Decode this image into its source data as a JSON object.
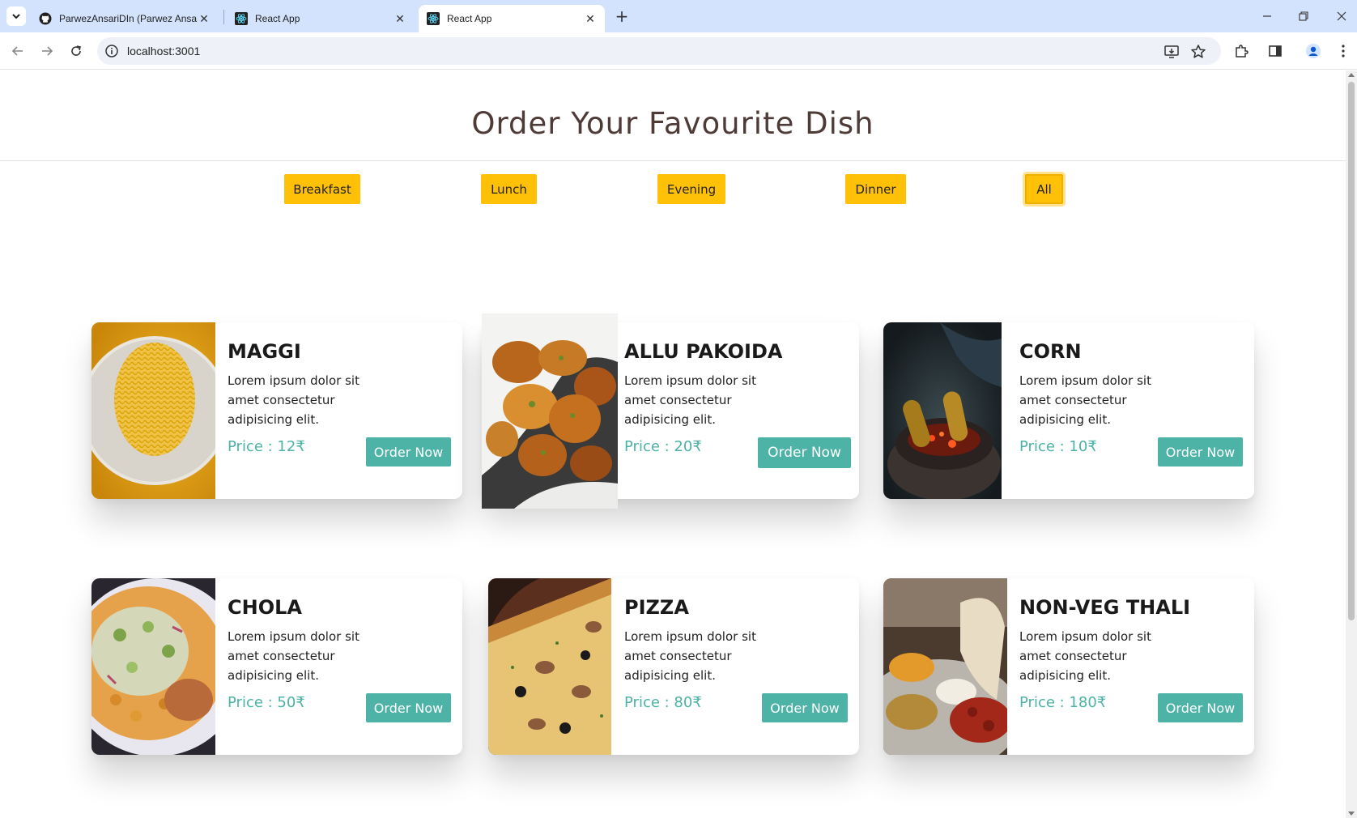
{
  "browser": {
    "tabs": [
      {
        "title": "ParwezAnsariDIn (Parwez Ansari)",
        "favicon": "github-icon",
        "active": false
      },
      {
        "title": "React App",
        "favicon": "react-icon",
        "active": false
      },
      {
        "title": "React App",
        "favicon": "react-icon",
        "active": true
      }
    ],
    "url": "localhost:3001"
  },
  "page": {
    "title": "Order Your Favourite Dish",
    "filters": [
      "Breakfast",
      "Lunch",
      "Evening",
      "Dinner",
      "All"
    ],
    "active_filter": "All",
    "order_label": "Order Now",
    "dishes": [
      {
        "name": "MAGGI",
        "desc": "Lorem ipsum dolor sit amet consectetur adipisicing elit.",
        "price": "Price : 12₹"
      },
      {
        "name": "ALLU PAKOIDA",
        "desc": "Lorem ipsum dolor sit amet consectetur adipisicing elit.",
        "price": "Price : 20₹"
      },
      {
        "name": "CORN",
        "desc": "Lorem ipsum dolor sit amet consectetur adipisicing elit.",
        "price": "Price : 10₹"
      },
      {
        "name": "CHOLA",
        "desc": "Lorem ipsum dolor sit amet consectetur adipisicing elit.",
        "price": "Price : 50₹"
      },
      {
        "name": "PIZZA",
        "desc": "Lorem ipsum dolor sit amet consectetur adipisicing elit.",
        "price": "Price : 80₹"
      },
      {
        "name": "NON-VEG THALI",
        "desc": "Lorem ipsum dolor sit amet consectetur adipisicing elit.",
        "price": "Price : 180₹"
      }
    ]
  },
  "colors": {
    "accent_yellow": "#ffc107",
    "teal": "#4cb3a6",
    "title_brown": "#4e3a36",
    "tabbar_blue": "#d3e3fd"
  }
}
